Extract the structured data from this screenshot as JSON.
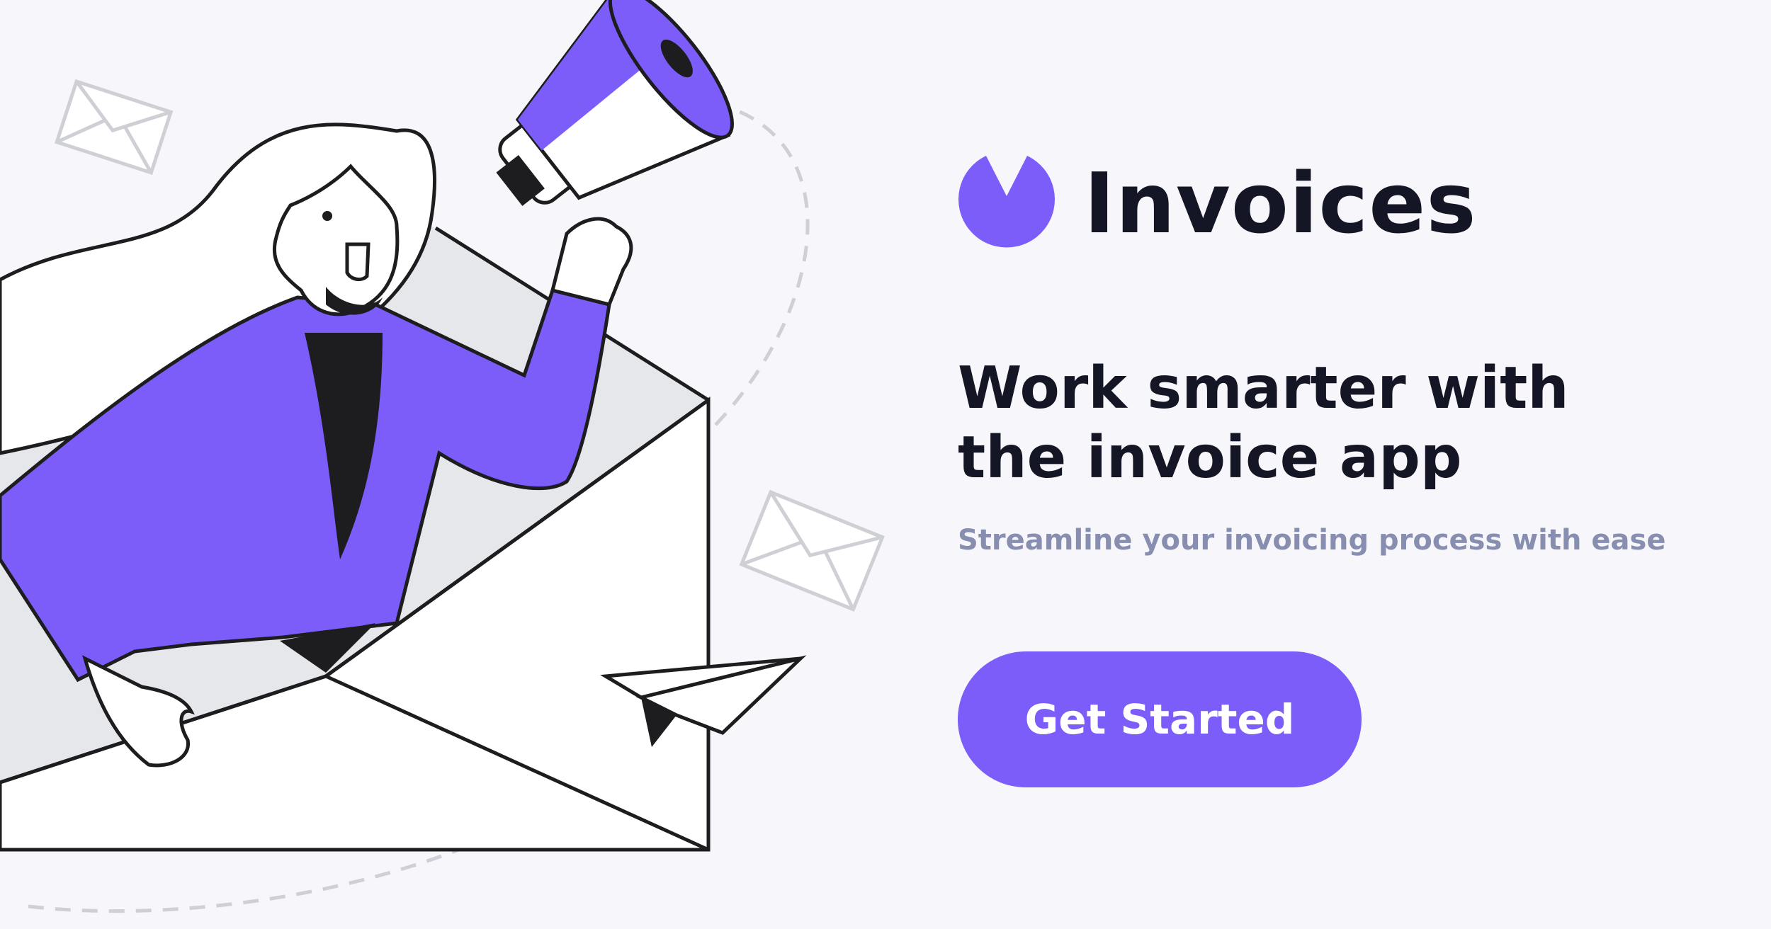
{
  "colors": {
    "accent": "#7c5dfa",
    "text_dark": "#141625",
    "text_muted": "#888eb0",
    "background": "#f7f7fb",
    "button_text": "#ffffff"
  },
  "brand": {
    "name": "Invoices",
    "logo_icon": "invoices-logo-icon"
  },
  "hero": {
    "headline_line1": "Work smarter with",
    "headline_line2": "the invoice app",
    "subtitle": "Streamline your invoicing process with ease"
  },
  "cta": {
    "label": "Get Started"
  },
  "illustration": {
    "description_icon": "woman-with-megaphone-in-envelope-illustration"
  }
}
